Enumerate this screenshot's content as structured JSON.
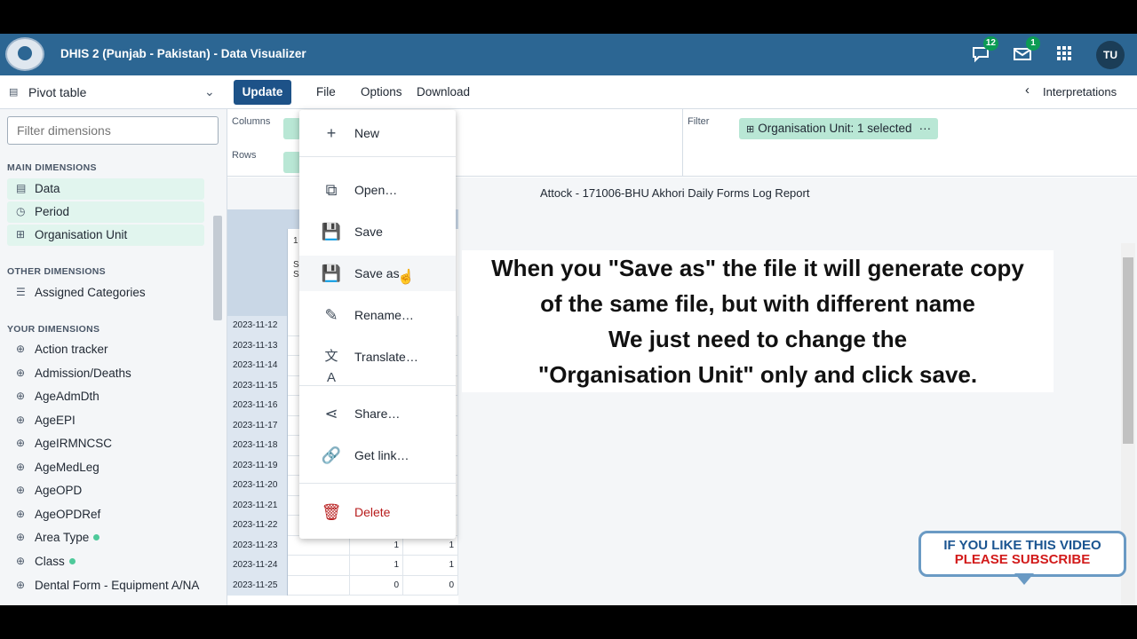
{
  "header": {
    "title": "DHIS 2 (Punjab - Pakistan) - Data Visualizer",
    "interpretations_badge": "12",
    "messages_badge": "1",
    "user_initials": "TU"
  },
  "toolbar": {
    "visualization_type": "Pivot table",
    "update_label": "Update",
    "menu_file": "File",
    "menu_options": "Options",
    "menu_download": "Download",
    "interpretations_label": "Interpretations"
  },
  "sidebar": {
    "filter_placeholder": "Filter dimensions",
    "main_title": "MAIN DIMENSIONS",
    "main": [
      {
        "label": "Data",
        "icon": "table-icon"
      },
      {
        "label": "Period",
        "icon": "clock-icon"
      },
      {
        "label": "Organisation Unit",
        "icon": "tree-icon"
      }
    ],
    "other_title": "OTHER DIMENSIONS",
    "other": [
      {
        "label": "Assigned Categories"
      }
    ],
    "yours_title": "YOUR DIMENSIONS",
    "yours": [
      {
        "label": "Action tracker"
      },
      {
        "label": "Admission/Deaths"
      },
      {
        "label": "AgeAdmDth"
      },
      {
        "label": "AgeEPI"
      },
      {
        "label": "AgeIRMNCSC"
      },
      {
        "label": "AgeMedLeg"
      },
      {
        "label": "AgeOPD"
      },
      {
        "label": "AgeOPDRef"
      },
      {
        "label": "Area Type",
        "selected": true
      },
      {
        "label": "Class",
        "selected": true
      },
      {
        "label": "Dental Form - Equipment A/NA"
      }
    ]
  },
  "layout": {
    "columns_label": "Columns",
    "rows_label": "Rows",
    "filter_label": "Filter",
    "filter_chip": "Organisation Unit: 1 selected"
  },
  "report": {
    "title": "Attock - 171006-BHU Akhori Daily Forms Log Report",
    "header_fragments": [
      "1",
      "S",
      "S"
    ],
    "rows": [
      {
        "date": "2023-11-12",
        "c1": "",
        "c2": ""
      },
      {
        "date": "2023-11-13",
        "c1": "",
        "c2": ""
      },
      {
        "date": "2023-11-14",
        "c1": "",
        "c2": ""
      },
      {
        "date": "2023-11-15",
        "c1": "",
        "c2": ""
      },
      {
        "date": "2023-11-16",
        "c1": "",
        "c2": ""
      },
      {
        "date": "2023-11-17",
        "c1": "",
        "c2": ""
      },
      {
        "date": "2023-11-18",
        "c1": "",
        "c2": ""
      },
      {
        "date": "2023-11-19",
        "c1": "",
        "c2": ""
      },
      {
        "date": "2023-11-20",
        "c1": "",
        "c2": ""
      },
      {
        "date": "2023-11-21",
        "c1": "",
        "c2": ""
      },
      {
        "date": "2023-11-22",
        "c1": "",
        "c2": ""
      },
      {
        "date": "2023-11-23",
        "c1": "1",
        "c2": "1"
      },
      {
        "date": "2023-11-24",
        "c1": "1",
        "c2": "1"
      },
      {
        "date": "2023-11-25",
        "c1": "0",
        "c2": "0"
      }
    ]
  },
  "file_menu": {
    "new": "New",
    "open": "Open…",
    "save": "Save",
    "save_as": "Save as",
    "rename": "Rename…",
    "translate": "Translate…",
    "share": "Share…",
    "get_link": "Get link…",
    "delete": "Delete"
  },
  "caption": {
    "line1": "When you \"Save as\" the file it will generate copy",
    "line2": "of the same file, but with different name",
    "line3": "We just need to change the",
    "line4": "\"Organisation Unit\" only and click save."
  },
  "subscribe": {
    "line1": "IF YOU LIKE THIS VIDEO",
    "line2": "PLEASE SUBSCRIBE"
  },
  "colors": {
    "header": "#2c6693",
    "update_button": "#1d5288",
    "chip": "#b9e7d5",
    "delete": "#b71c1c"
  }
}
